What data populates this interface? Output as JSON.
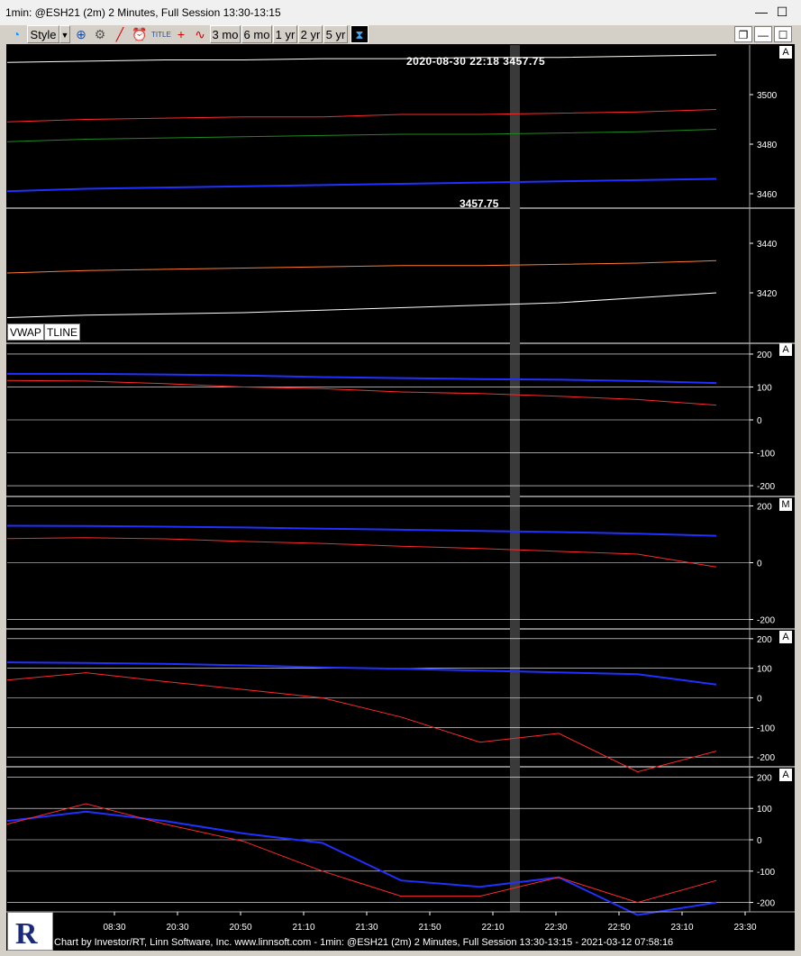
{
  "window": {
    "title": "1min: @ESH21 (2m) 2 Minutes, Full Session 13:30-13:15",
    "min_label": "—",
    "max_label": "☐",
    "close_label": "✕"
  },
  "toolbar": {
    "style_label": "Style",
    "ranges": [
      "3 mo",
      "6 mo",
      "1 yr",
      "2 yr",
      "5 yr"
    ],
    "icons": [
      "stopwatch-icon",
      "zoom-icon",
      "gear-icon",
      "trendline-icon",
      "alarm-icon",
      "title-icon",
      "crosshair-icon",
      "wave-icon",
      "hourglass-icon"
    ]
  },
  "chart": {
    "date_label": "2020-08-30 22:18  3457.75",
    "price_label": "3457.75",
    "vwap_label": "VWAP",
    "tline_label": "TLINE",
    "footer": "Chart by Investor/RT, Linn Software, Inc. www.linnsoft.com - 1min: @ESH21 (2m) 2 Minutes, Full Session 13:30-13:15 - 2021-03-12 07:58:16",
    "colors": {
      "bg": "#000000",
      "white": "#ffffff",
      "red": "#ff2a2a",
      "green": "#1f8a1f",
      "blue": "#2030ff",
      "orange": "#ff7a30",
      "grid": "#ffffff"
    }
  },
  "chart_data": [
    {
      "type": "line",
      "panel": "price",
      "ylim": [
        3400,
        3520
      ],
      "yticks": [
        3500,
        3480,
        3460,
        3440,
        3420
      ],
      "panel_label": "A",
      "x": [
        "08:30",
        "20:30",
        "20:50",
        "21:10",
        "21:30",
        "21:50",
        "22:10",
        "22:30",
        "22:50",
        "23:10",
        "23:30"
      ],
      "series": [
        {
          "color": "white",
          "values": [
            3513,
            3513.5,
            3514,
            3514,
            3514.5,
            3514.5,
            3515,
            3515,
            3515.5,
            3516
          ]
        },
        {
          "color": "red",
          "values": [
            3489,
            3490,
            3490.5,
            3491,
            3491,
            3492,
            3492,
            3492.5,
            3493,
            3494
          ]
        },
        {
          "color": "green",
          "values": [
            3481,
            3482,
            3482.5,
            3483,
            3483.5,
            3484,
            3484,
            3484.5,
            3485,
            3486
          ]
        },
        {
          "color": "blue",
          "values": [
            3461,
            3462,
            3462.5,
            3463,
            3463.5,
            3464,
            3464.5,
            3465,
            3465.5,
            3466
          ]
        },
        {
          "color": "orange",
          "values": [
            3428,
            3429,
            3429.5,
            3430,
            3430.5,
            3431,
            3431,
            3431.5,
            3432,
            3433
          ]
        },
        {
          "color": "white-lower",
          "values": [
            3410,
            3411,
            3411.5,
            3412,
            3413,
            3414,
            3415,
            3416,
            3418,
            3420
          ]
        }
      ]
    },
    {
      "type": "line",
      "panel": "osc1",
      "ylim": [
        -230,
        230
      ],
      "yticks": [
        200,
        100,
        0,
        -100,
        -200
      ],
      "panel_label": "A",
      "series": [
        {
          "color": "blue",
          "values": [
            140,
            140,
            138,
            135,
            130,
            127,
            124,
            122,
            118,
            112
          ]
        },
        {
          "color": "red",
          "values": [
            120,
            118,
            110,
            100,
            95,
            85,
            80,
            72,
            62,
            45
          ]
        }
      ]
    },
    {
      "type": "line",
      "panel": "osc2",
      "ylim": [
        -230,
        230
      ],
      "yticks": [
        200,
        0,
        -200
      ],
      "panel_label": "M",
      "series": [
        {
          "color": "blue",
          "values": [
            130,
            129,
            127,
            124,
            120,
            116,
            112,
            108,
            102,
            95
          ]
        },
        {
          "color": "red",
          "values": [
            85,
            88,
            84,
            75,
            68,
            58,
            50,
            40,
            30,
            -15
          ]
        }
      ]
    },
    {
      "type": "line",
      "panel": "osc3",
      "ylim": [
        -230,
        230
      ],
      "yticks": [
        200,
        100,
        0,
        -100,
        -200
      ],
      "panel_label": "A",
      "series": [
        {
          "color": "blue",
          "values": [
            120,
            118,
            115,
            110,
            103,
            98,
            92,
            86,
            80,
            45
          ]
        },
        {
          "color": "red",
          "values": [
            60,
            85,
            55,
            28,
            0,
            -65,
            -150,
            -120,
            -250,
            -180
          ]
        }
      ]
    },
    {
      "type": "line",
      "panel": "osc4",
      "ylim": [
        -230,
        230
      ],
      "yticks": [
        200,
        100,
        0,
        -100,
        -200
      ],
      "panel_label": "A",
      "series": [
        {
          "color": "blue",
          "values": [
            60,
            90,
            60,
            20,
            -10,
            -130,
            -150,
            -120,
            -240,
            -200
          ]
        },
        {
          "color": "red",
          "values": [
            50,
            115,
            50,
            -5,
            -100,
            -180,
            -180,
            -120,
            -200,
            -130
          ]
        }
      ]
    }
  ]
}
